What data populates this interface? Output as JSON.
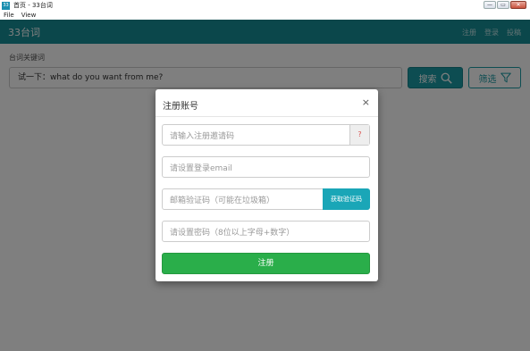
{
  "window": {
    "title": "首页 - 33台词",
    "icon_text": "33",
    "controls": {
      "minimize": "—",
      "maximize": "▭",
      "close": "✕"
    }
  },
  "menu": {
    "items": [
      "File",
      "View"
    ]
  },
  "navbar": {
    "brand": "33台词",
    "links": [
      "注册",
      "登录",
      "投稿"
    ]
  },
  "search": {
    "label": "台词关键词",
    "value": "试一下：what do you want from me?",
    "search_button": "搜索",
    "filter_button": "筛选"
  },
  "modal": {
    "title": "注册账号",
    "close_symbol": "×",
    "fields": {
      "invite_placeholder": "请输入注册邀请码",
      "invite_help": "?",
      "email_placeholder": "请设置登录email",
      "code_placeholder": "邮箱验证码（可能在垃圾箱）",
      "code_button": "获取验证码",
      "password_placeholder": "请设置密码（8位以上字母+数字）"
    },
    "submit_label": "注册"
  },
  "colors": {
    "navbar": "#168e96",
    "primary": "#1a9aa4",
    "success": "#2aae4a",
    "danger": "#d9534f"
  }
}
